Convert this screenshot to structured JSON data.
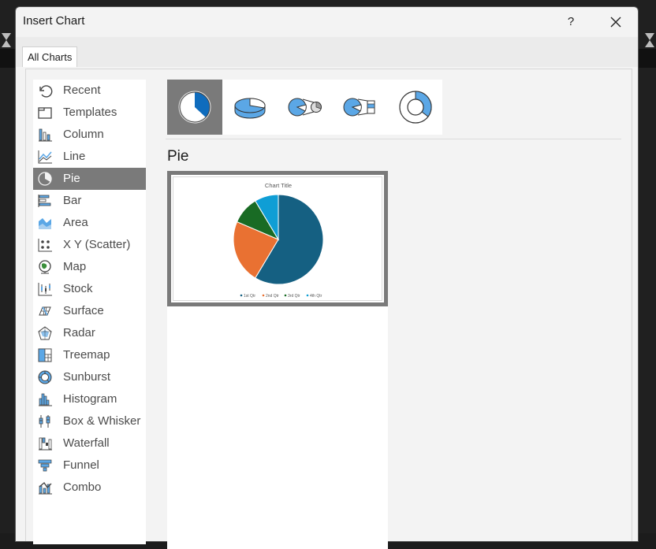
{
  "dialog": {
    "title": "Insert Chart",
    "help_label": "?",
    "tab_label": "All Charts"
  },
  "nav": {
    "items": [
      {
        "label": "Recent",
        "icon": "recent-icon"
      },
      {
        "label": "Templates",
        "icon": "templates-icon"
      },
      {
        "label": "Column",
        "icon": "column-chart-icon"
      },
      {
        "label": "Line",
        "icon": "line-chart-icon"
      },
      {
        "label": "Pie",
        "icon": "pie-chart-icon",
        "selected": true
      },
      {
        "label": "Bar",
        "icon": "bar-chart-icon"
      },
      {
        "label": "Area",
        "icon": "area-chart-icon"
      },
      {
        "label": "X Y (Scatter)",
        "icon": "scatter-chart-icon"
      },
      {
        "label": "Map",
        "icon": "map-chart-icon"
      },
      {
        "label": "Stock",
        "icon": "stock-chart-icon"
      },
      {
        "label": "Surface",
        "icon": "surface-chart-icon"
      },
      {
        "label": "Radar",
        "icon": "radar-chart-icon"
      },
      {
        "label": "Treemap",
        "icon": "treemap-chart-icon"
      },
      {
        "label": "Sunburst",
        "icon": "sunburst-chart-icon"
      },
      {
        "label": "Histogram",
        "icon": "histogram-chart-icon"
      },
      {
        "label": "Box & Whisker",
        "icon": "box-whisker-chart-icon"
      },
      {
        "label": "Waterfall",
        "icon": "waterfall-chart-icon"
      },
      {
        "label": "Funnel",
        "icon": "funnel-chart-icon"
      },
      {
        "label": "Combo",
        "icon": "combo-chart-icon"
      }
    ]
  },
  "subtypes": [
    {
      "icon": "pie-subtype-icon",
      "selected": true
    },
    {
      "icon": "3d-pie-subtype-icon"
    },
    {
      "icon": "pie-of-pie-subtype-icon"
    },
    {
      "icon": "bar-of-pie-subtype-icon"
    },
    {
      "icon": "doughnut-subtype-icon"
    }
  ],
  "selected_type_title": "Pie",
  "chart_data": {
    "type": "pie",
    "title": "Chart Title",
    "categories": [
      "1st Qtr",
      "2nd Qtr",
      "3rd Qtr",
      "4th Qtr"
    ],
    "values": [
      8.2,
      3.2,
      1.4,
      1.2
    ],
    "colors": [
      "#156082",
      "#e97132",
      "#196b24",
      "#0f9ed5"
    ],
    "legend": "bottom"
  },
  "colors": {
    "accent": "#0f6cbd",
    "selected_bg": "#7a7a7a",
    "icon_blue": "#5ba7e6"
  }
}
